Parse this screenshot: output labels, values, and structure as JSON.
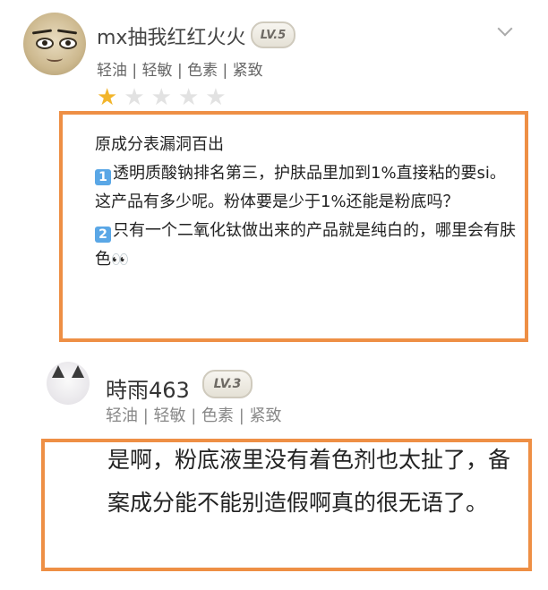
{
  "comments": [
    {
      "username": "mx抽我红红火火",
      "level": "LV.5",
      "tags": "轻油 | 轻敏 | 色素 | 紧致",
      "rating": 1,
      "rating_max": 5,
      "lines": {
        "l1": "原成分表漏洞百出",
        "n1": "1",
        "l2": "透明质酸钠排名第三，护肤品里加到1%直接粘的要si。这产品有多少呢。粉体要是少于1%还能是粉底吗？",
        "n2": "2",
        "l3": "只有一个二氧化钛做出来的产品就是纯白的，哪里会有肤色",
        "emoji": "👀"
      }
    },
    {
      "username": "時雨463",
      "level": "LV.3",
      "tags": "轻油 | 轻敏 | 色素 | 紧致",
      "text": "是啊，粉底液里没有着色剂也太扯了，备案成分能不能别造假啊真的很无语了。"
    }
  ],
  "colors": {
    "highlight_border": "#ee8f45",
    "star_on": "#f2b52b",
    "star_off": "#e2e2e2",
    "keycap_blue": "#5aa7e6"
  },
  "icons": {
    "more": "chevron-down-icon",
    "star": "star-icon"
  }
}
